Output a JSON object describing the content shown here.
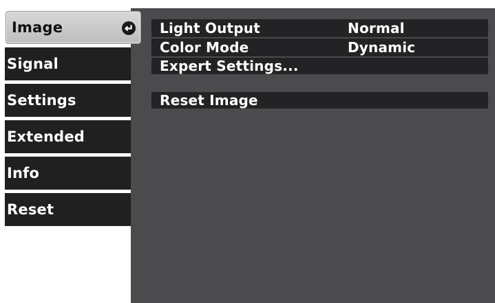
{
  "sidebar": {
    "tabs": [
      {
        "label": "Image",
        "active": true
      },
      {
        "label": "Signal"
      },
      {
        "label": "Settings"
      },
      {
        "label": "Extended"
      },
      {
        "label": "Info"
      },
      {
        "label": "Reset"
      }
    ]
  },
  "menu": {
    "items": [
      {
        "label": "Light Output",
        "value": "Normal"
      },
      {
        "label": "Color Mode",
        "value": "Dynamic"
      },
      {
        "label": "Expert Settings..."
      },
      {
        "label": "Reset Image"
      }
    ]
  },
  "colors": {
    "panel_background": "#4b4b4d",
    "tab_background": "#202020",
    "active_tab_background": "#c9c9c9",
    "row_background": "#232325",
    "text": "#ffffff"
  },
  "icons": {
    "active_tab_indicator": "enter-return-icon"
  }
}
